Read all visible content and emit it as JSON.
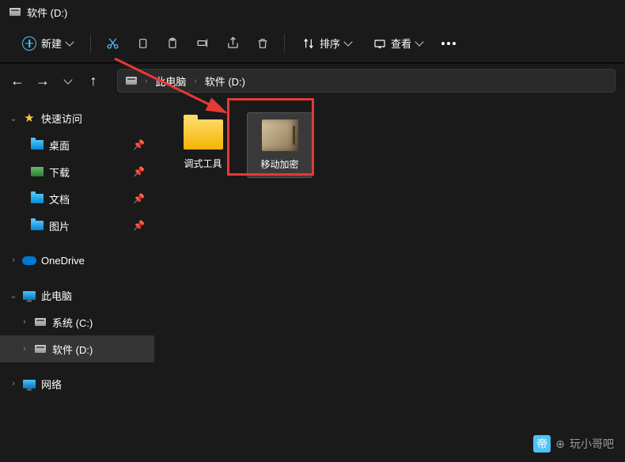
{
  "title": "软件 (D:)",
  "toolbar": {
    "new": "新建",
    "sort": "排序",
    "view": "查看"
  },
  "breadcrumb": {
    "pc": "此电脑",
    "drive": "软件 (D:)"
  },
  "sidebar": {
    "quickAccess": "快速访问",
    "desktop": "桌面",
    "downloads": "下载",
    "documents": "文档",
    "pictures": "图片",
    "onedrive": "OneDrive",
    "thisPC": "此电脑",
    "systemC": "系统 (C:)",
    "softwareD": "软件 (D:)",
    "network": "网络"
  },
  "items": [
    {
      "name": "调式工具"
    },
    {
      "name": "移动加密"
    }
  ],
  "watermark": "玩小哥吧"
}
